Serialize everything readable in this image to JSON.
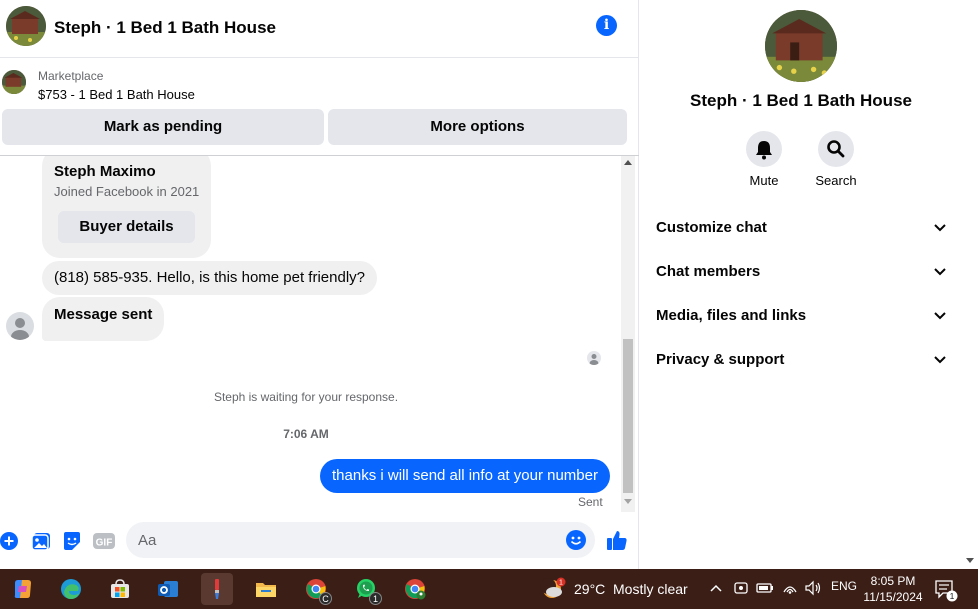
{
  "chat": {
    "title": "Steph · 1 Bed 1 Bath House",
    "marketplace": {
      "label": "Marketplace",
      "listing": "$753 - 1 Bed 1 Bath House",
      "pending_button": "Mark as pending",
      "more_button": "More options"
    },
    "buyer": {
      "name": "Steph Maximo",
      "joined": "Joined Facebook in 2021",
      "details_button": "Buyer details"
    },
    "messages": [
      {
        "text": "(818) 585-935. Hello, is this home pet friendly?"
      },
      {
        "text": "Message sent"
      }
    ],
    "waiting": "Steph is waiting for your response.",
    "time": "7:06 AM",
    "outgoing": "thanks i will send all info at your number",
    "status": "Sent",
    "composer": {
      "placeholder": "Aa",
      "gif_label": "GIF"
    }
  },
  "panel": {
    "title": "Steph · 1 Bed 1 Bath House",
    "actions": [
      {
        "label": "Mute"
      },
      {
        "label": "Search"
      }
    ],
    "sections": [
      {
        "label": "Customize chat"
      },
      {
        "label": "Chat members"
      },
      {
        "label": "Media, files and links"
      },
      {
        "label": "Privacy & support"
      }
    ]
  },
  "taskbar": {
    "weather": {
      "temp": "29°C",
      "condition": "Mostly clear",
      "alert_count": "1"
    },
    "language": "ENG",
    "time": "8:05 PM",
    "date": "11/15/2024",
    "notification_count": "1",
    "whatsapp_badge": "1",
    "chrome_badge": "C"
  },
  "colors": {
    "accent": "#0866ff",
    "taskbar": "#3b1e16"
  }
}
